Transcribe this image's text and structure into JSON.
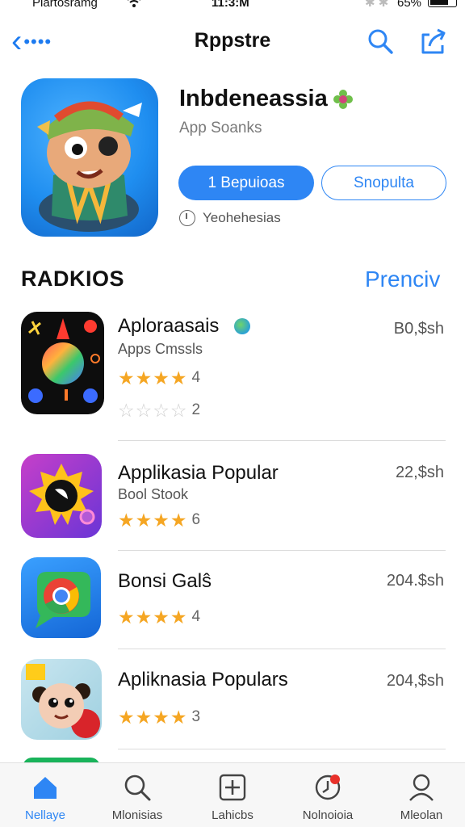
{
  "status_bar": {
    "carrier": "Plartosramg",
    "time": "11:3:M",
    "battery_pct": "65%"
  },
  "nav": {
    "back_icon": "chevron-left-icon",
    "title": "Rppstre",
    "search_icon": "search-icon",
    "share_icon": "share-icon"
  },
  "featured": {
    "title": "Inbdeneassia",
    "subtitle": "App Soanks",
    "primary_button": "1 Bepuioas",
    "secondary_button": "Snopulta",
    "note": "Yeohehesias"
  },
  "section": {
    "title": "RADKIOS",
    "link": "Prenciv"
  },
  "apps": [
    {
      "name": "Aploraasais",
      "subtitle": "Apps Cmssls",
      "price": "B0,$sh",
      "rating_a": 4,
      "count_a": "4",
      "rating_b": 0,
      "count_b": "2"
    },
    {
      "name": "Applikasia Popular",
      "subtitle": "Bool Stook",
      "price": "22,$sh",
      "rating": 4,
      "count": "6"
    },
    {
      "name": "Bonsi Galŝ",
      "subtitle": "",
      "price": "204.$sh",
      "rating": 4,
      "count": "4"
    },
    {
      "name": "Apliknasia Populars",
      "subtitle": "",
      "price": "204,$sh",
      "rating": 4,
      "count": "3"
    }
  ],
  "tabs": [
    {
      "label": "Nellaye",
      "icon": "home-icon",
      "active": true
    },
    {
      "label": "Mlonisias",
      "icon": "search-icon",
      "active": false
    },
    {
      "label": "Lahicbs",
      "icon": "plus-square-icon",
      "active": false
    },
    {
      "label": "Nolnoioia",
      "icon": "notification-icon",
      "active": false
    },
    {
      "label": "Mleolan",
      "icon": "profile-icon",
      "active": false
    }
  ],
  "colors": {
    "accent": "#2e86f4",
    "star": "#f5a623",
    "star_empty": "#cfcfcf"
  }
}
